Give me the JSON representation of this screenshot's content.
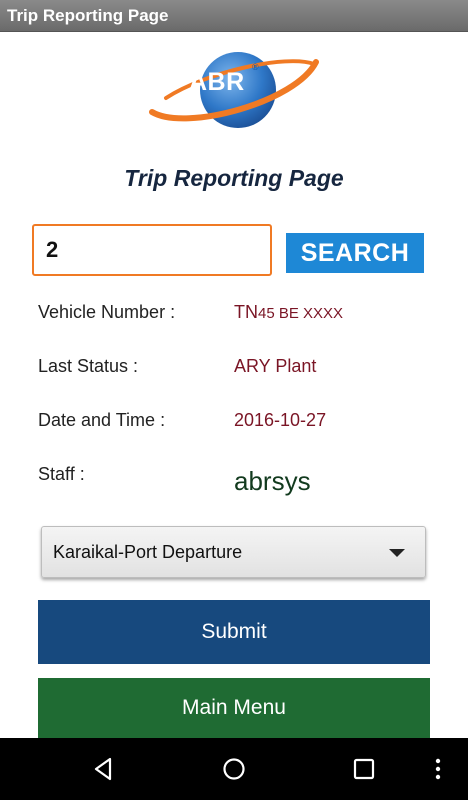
{
  "window": {
    "title": "Trip Reporting Page"
  },
  "logo": {
    "text": "ABR",
    "registered": "®"
  },
  "page": {
    "heading": "Trip Reporting Page"
  },
  "search": {
    "value": "2",
    "button_label": "SEARCH"
  },
  "details": {
    "vehicle_label": "Vehicle Number :",
    "vehicle_prefix": "TN",
    "vehicle_rest": "45 BE XXXX",
    "status_label": "Last Status :",
    "status_value": "ARY Plant",
    "datetime_label": "Date and Time :",
    "datetime_value": "2016-10-27",
    "staff_label": "Staff :",
    "staff_value": "abrsys"
  },
  "dropdown": {
    "selected": "Karaikal-Port Departure"
  },
  "buttons": {
    "submit": "Submit",
    "main_menu": "Main Menu"
  },
  "colors": {
    "titlebar": "#7a7a7a",
    "accent_orange": "#f07a24",
    "search_blue": "#1e88d6",
    "value_red": "#7a1525",
    "staff_green": "#123a1e",
    "submit_blue": "#17497e",
    "main_menu_green": "#1f6b33"
  },
  "nav": {
    "icons": [
      "back-icon",
      "home-icon",
      "recent-apps-icon",
      "overflow-menu-icon"
    ]
  }
}
